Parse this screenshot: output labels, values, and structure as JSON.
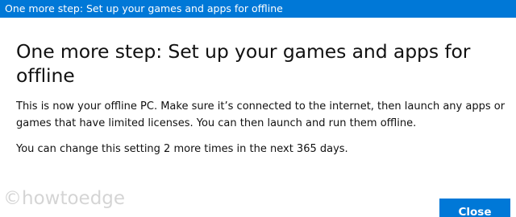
{
  "window": {
    "title": "One more step: Set up your games and apps for offline"
  },
  "dialog": {
    "heading": "One more step: Set up your games and apps for offline",
    "paragraph1": "This is now your offline PC. Make sure it’s connected to the internet, then launch any apps or games that have limited licenses. You can then launch and run them offline.",
    "paragraph2": "You can change this setting 2 more times in the next 365 days.",
    "close_label": "Close"
  },
  "watermark": {
    "text": "©howtoedge"
  },
  "colors": {
    "accent": "#0078d7",
    "background": "#ffffff",
    "text": "#111111"
  }
}
